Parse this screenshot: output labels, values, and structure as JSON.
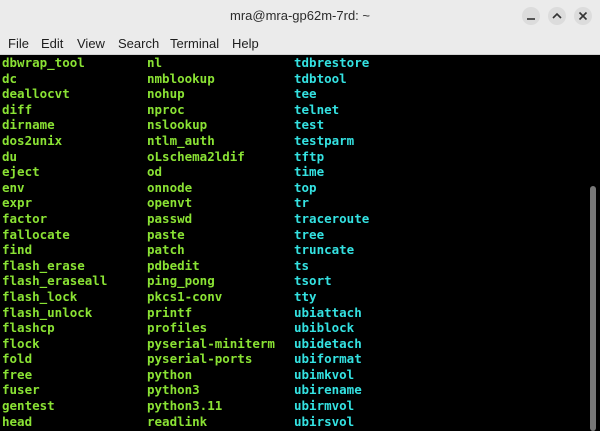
{
  "window": {
    "title": "mra@mra-gp62m-7rd: ~"
  },
  "menubar": {
    "items": [
      "File",
      "Edit",
      "View",
      "Search",
      "Terminal",
      "Help"
    ]
  },
  "colors": {
    "executable": "#8ae234",
    "symlink": "#34e2e2",
    "background": "#000000"
  },
  "icons": [
    "minimize-icon",
    "maximize-icon",
    "close-icon"
  ],
  "terminal": {
    "col1": [
      "dbwrap_tool",
      "dc",
      "deallocvt",
      "diff",
      "dirname",
      "dos2unix",
      "du",
      "eject",
      "env",
      "expr",
      "factor",
      "fallocate",
      "find",
      "flash_erase",
      "flash_eraseall",
      "flash_lock",
      "flash_unlock",
      "flashcp",
      "flock",
      "fold",
      "free",
      "fuser",
      "gentest",
      "head"
    ],
    "col2": [
      "nl",
      "nmblookup",
      "nohup",
      "nproc",
      "nslookup",
      "ntlm_auth",
      "oLschema2ldif",
      "od",
      "onnode",
      "openvt",
      "passwd",
      "paste",
      "patch",
      "pdbedit",
      "ping_pong",
      "pkcs1-conv",
      "printf",
      "profiles",
      "pyserial-miniterm",
      "pyserial-ports",
      "python",
      "python3",
      "python3.11",
      "readlink"
    ],
    "col3": [
      "tdbrestore",
      "tdbtool",
      "tee",
      "telnet",
      "test",
      "testparm",
      "tftp",
      "time",
      "top",
      "tr",
      "traceroute",
      "tree",
      "truncate",
      "ts",
      "tsort",
      "tty",
      "ubiattach",
      "ubiblock",
      "ubidetach",
      "ubiformat",
      "ubimkvol",
      "ubirename",
      "ubirmvol",
      "ubirsvol"
    ]
  }
}
